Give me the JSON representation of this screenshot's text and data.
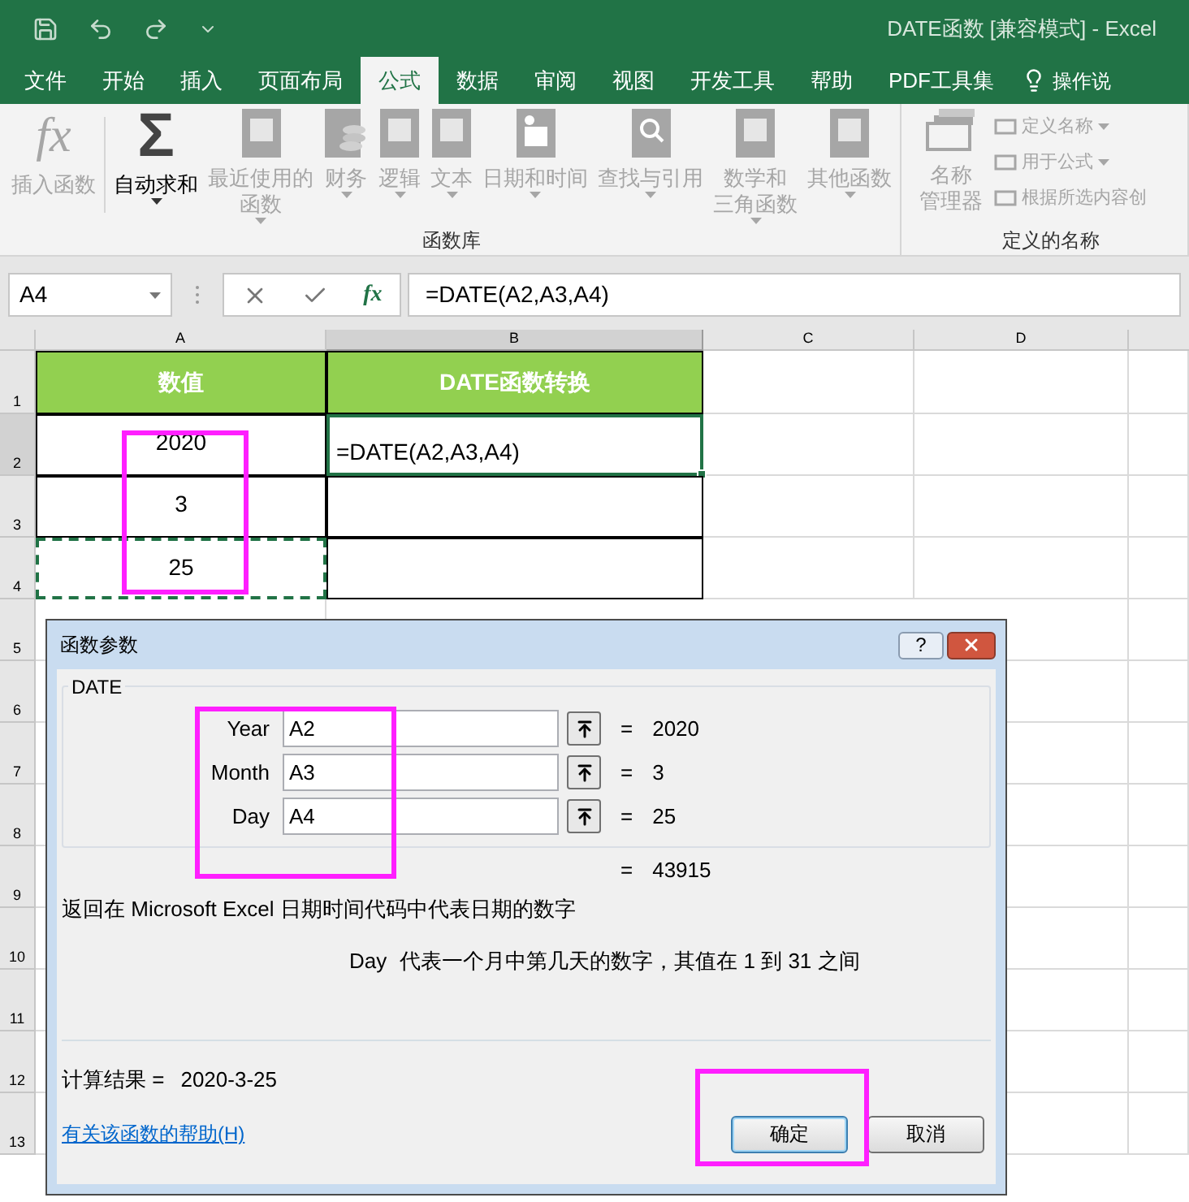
{
  "window": {
    "title": "DATE函数  [兼容模式]  -  Excel"
  },
  "ribbon_tabs": [
    {
      "label": "文件",
      "selected": false
    },
    {
      "label": "开始",
      "selected": false
    },
    {
      "label": "插入",
      "selected": false
    },
    {
      "label": "页面布局",
      "selected": false
    },
    {
      "label": "公式",
      "selected": true
    },
    {
      "label": "数据",
      "selected": false
    },
    {
      "label": "审阅",
      "selected": false
    },
    {
      "label": "视图",
      "selected": false
    },
    {
      "label": "开发工具",
      "selected": false
    },
    {
      "label": "帮助",
      "selected": false
    },
    {
      "label": "PDF工具集",
      "selected": false
    }
  ],
  "tell_me": "操作说",
  "ribbon_groups": [
    {
      "label": "函数库",
      "buttons": [
        {
          "kind": "glyph",
          "glyph": "fx",
          "label": "插入函数",
          "disabled": true,
          "dropdown": false
        },
        {
          "kind": "glyph",
          "glyph": "Σ",
          "label": "自动求和",
          "disabled": false,
          "dropdown": true
        },
        {
          "kind": "book",
          "label": "最近使用的",
          "label2": "函数",
          "disabled": true,
          "dropdown": true
        },
        {
          "kind": "coins",
          "label": "财务",
          "disabled": true,
          "dropdown": true
        },
        {
          "kind": "book",
          "label": "逻辑",
          "disabled": true,
          "dropdown": true
        },
        {
          "kind": "book",
          "label": "文本",
          "disabled": true,
          "dropdown": true
        },
        {
          "kind": "calendar",
          "label": "日期和时间",
          "disabled": true,
          "dropdown": true
        },
        {
          "kind": "magnifier",
          "label": "查找与引用",
          "disabled": true,
          "dropdown": true
        },
        {
          "kind": "book",
          "label": "数学和",
          "label2": "三角函数",
          "disabled": true,
          "dropdown": true
        },
        {
          "kind": "book",
          "label": "其他函数",
          "disabled": true,
          "dropdown": true
        }
      ]
    },
    {
      "label": "定义的名称",
      "buttons": [
        {
          "kind": "tags",
          "label": "名称",
          "label2": "管理器",
          "disabled": true,
          "dropdown": false
        }
      ],
      "small_items": [
        {
          "label": "定义名称",
          "disabled": true,
          "dropdown": true
        },
        {
          "label": "用于公式",
          "disabled": true,
          "dropdown": true
        },
        {
          "label": "根据所选内容创",
          "disabled": true,
          "dropdown": false
        }
      ]
    }
  ],
  "formula_bar": {
    "name_box": "A4",
    "fx": "fx",
    "formula": "=DATE(A2,A3,A4)"
  },
  "sheet": {
    "columns": [
      {
        "label": "A",
        "selected": false
      },
      {
        "label": "B",
        "selected": true
      },
      {
        "label": "C",
        "selected": false
      },
      {
        "label": "D",
        "selected": false
      }
    ],
    "rows": [
      {
        "label": "1",
        "selected": false,
        "cells": [
          {
            "kind": "header",
            "text": "数值",
            "selected": false,
            "dashed": false
          },
          {
            "kind": "header",
            "text": "DATE函数转换",
            "selected": false,
            "dashed": false
          }
        ]
      },
      {
        "label": "2",
        "selected": true,
        "cells": [
          {
            "kind": "box",
            "text": "2020",
            "selected": false,
            "dashed": false
          },
          {
            "kind": "box",
            "text": "=DATE(A2,A3,A4)",
            "selected": true,
            "dashed": false
          }
        ]
      },
      {
        "label": "3",
        "selected": false,
        "cells": [
          {
            "kind": "box",
            "text": "3",
            "selected": false,
            "dashed": false
          },
          {
            "kind": "box",
            "selected": false,
            "dashed": false
          }
        ]
      },
      {
        "label": "4",
        "selected": false,
        "cells": [
          {
            "kind": "box",
            "text": "25",
            "selected": false,
            "dashed": true
          },
          {
            "kind": "box",
            "selected": false,
            "dashed": false
          }
        ]
      },
      {
        "label": "5",
        "selected": false
      },
      {
        "label": "6",
        "selected": false
      },
      {
        "label": "7",
        "selected": false
      },
      {
        "label": "8",
        "selected": false
      },
      {
        "label": "9",
        "selected": false
      },
      {
        "label": "10",
        "selected": false
      },
      {
        "label": "11",
        "selected": false
      },
      {
        "label": "12",
        "selected": false
      },
      {
        "label": "13",
        "selected": false
      }
    ]
  },
  "dialog": {
    "title": "函数参数",
    "help_button": "?",
    "function_name": "DATE",
    "arguments": [
      {
        "label": "Year",
        "value": "A2",
        "equals": "=",
        "result": "2020"
      },
      {
        "label": "Month",
        "value": "A3",
        "equals": "=",
        "result": "3"
      },
      {
        "label": "Day",
        "value": "A4",
        "equals": "=",
        "result": "25"
      }
    ],
    "total_equals": "=",
    "total_result": "43915",
    "description": "返回在 Microsoft Excel 日期时间代码中代表日期的数字",
    "argument_help": {
      "name": "Day",
      "text": "代表一个月中第几天的数字，其值在 1 到 31 之间"
    },
    "result_label": "计算结果 =",
    "result_value": "2020-3-25",
    "help_link": "有关该函数的帮助(H)",
    "buttons": [
      {
        "label": "确定",
        "default": true
      },
      {
        "label": "取消",
        "default": false
      }
    ]
  }
}
